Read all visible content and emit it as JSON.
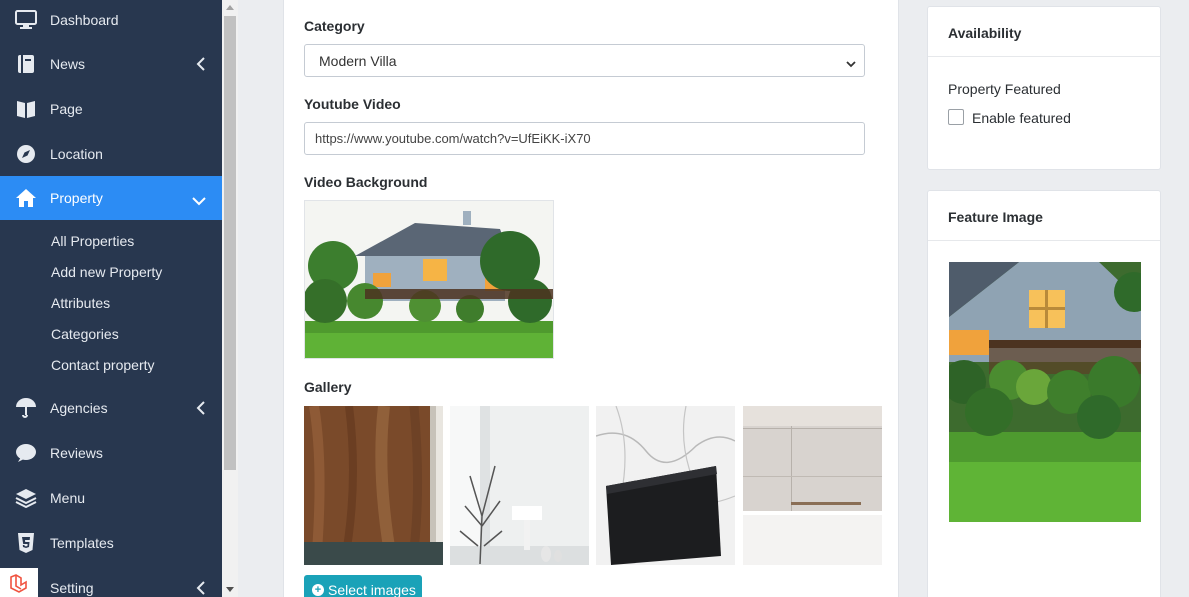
{
  "sidebar": {
    "items": [
      {
        "label": "Dashboard",
        "icon": "monitor-icon"
      },
      {
        "label": "News",
        "icon": "book-icon"
      },
      {
        "label": "Page",
        "icon": "pages-icon"
      },
      {
        "label": "Location",
        "icon": "compass-icon"
      },
      {
        "label": "Property",
        "icon": "home-icon"
      },
      {
        "label": "Agencies",
        "icon": "umbrella-icon"
      },
      {
        "label": "Reviews",
        "icon": "comment-icon"
      },
      {
        "label": "Menu",
        "icon": "layers-icon"
      },
      {
        "label": "Templates",
        "icon": "html5-icon"
      },
      {
        "label": "Setting",
        "icon": "laravel-icon"
      }
    ],
    "property_submenu": [
      "All Properties",
      "Add new Property",
      "Attributes",
      "Categories",
      "Contact property"
    ]
  },
  "form": {
    "category_label": "Category",
    "category_value": "Modern Villa",
    "youtube_label": "Youtube Video",
    "youtube_value": "https://www.youtube.com/watch?v=UfEiKK-iX70",
    "video_bg_label": "Video Background",
    "gallery_label": "Gallery",
    "select_images_label": "Select images"
  },
  "availability": {
    "title": "Availability",
    "featured_label": "Property Featured",
    "enable_featured_label": "Enable featured",
    "featured_checked": false
  },
  "feature_image": {
    "title": "Feature Image"
  },
  "colors": {
    "sidebar_bg": "#28374f",
    "active_item": "#2c8cf4",
    "button_teal": "#1aa2b8"
  }
}
